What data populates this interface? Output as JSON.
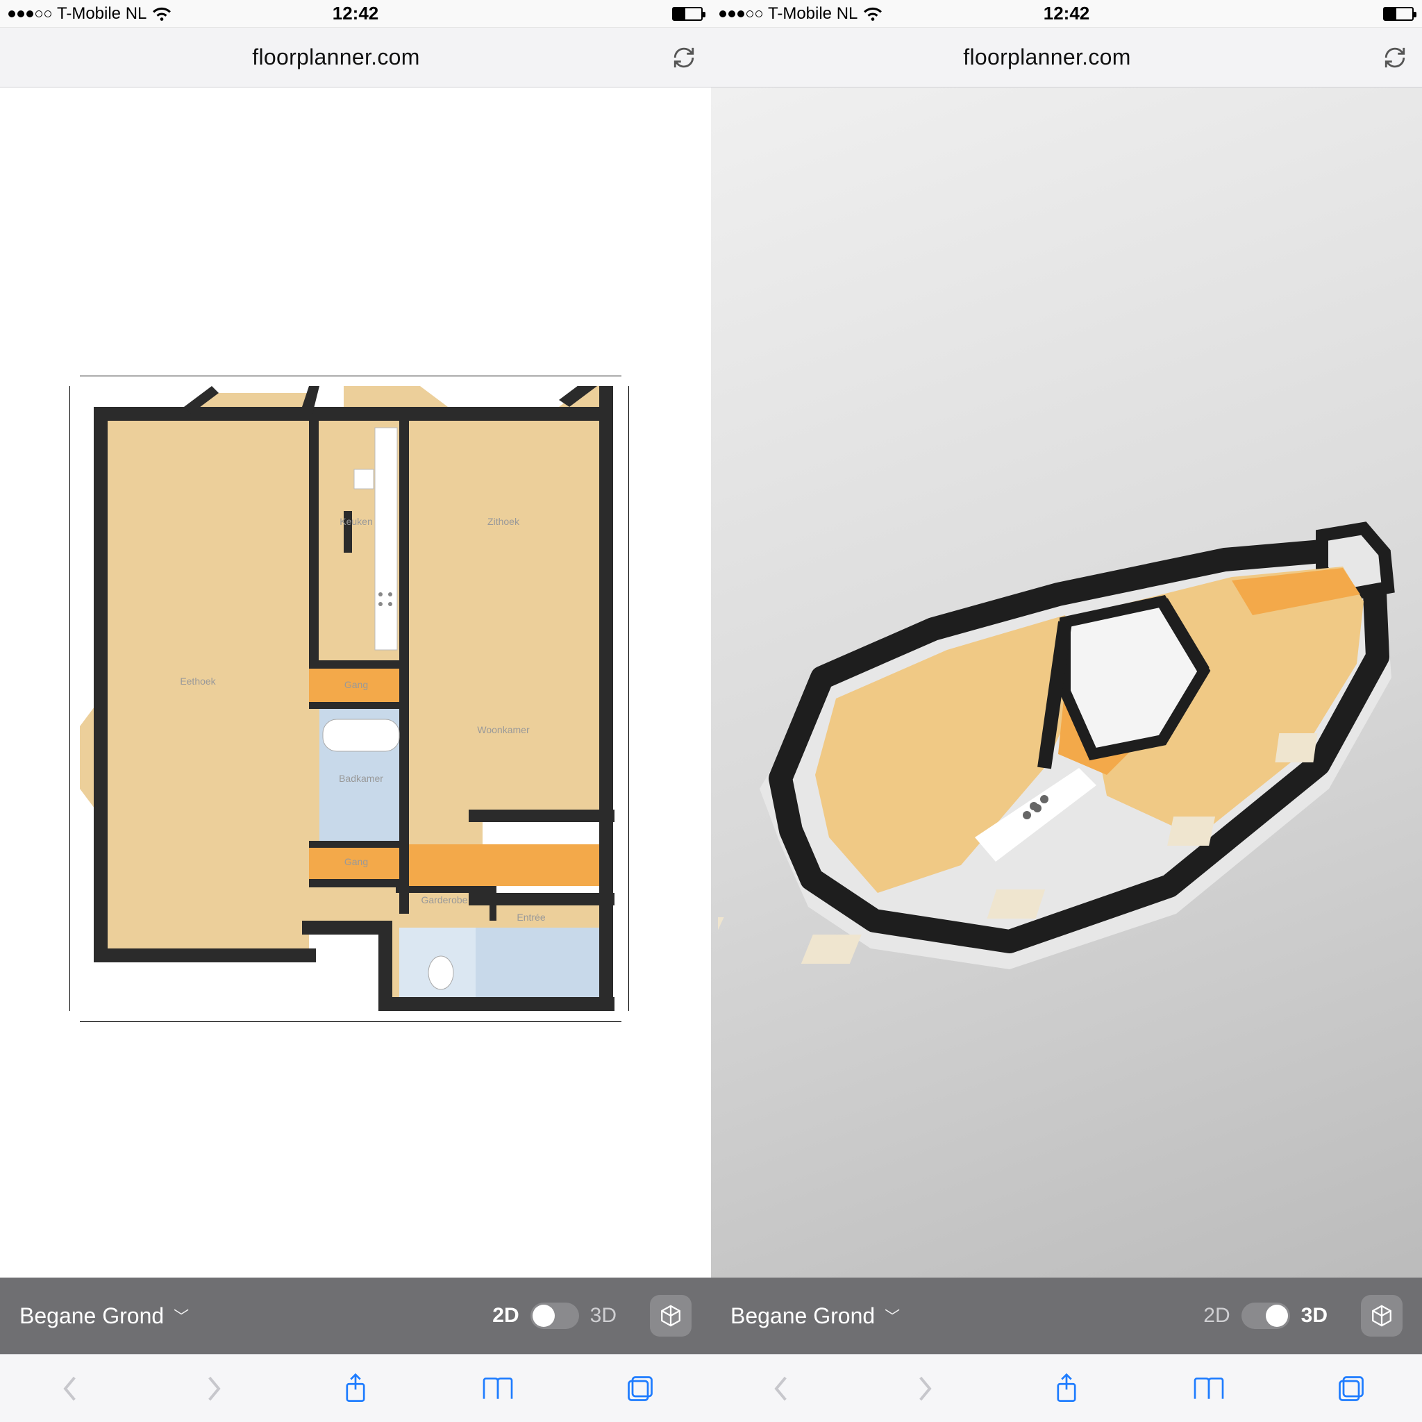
{
  "status": {
    "carrier": "T-Mobile NL",
    "time": "12:42"
  },
  "browser": {
    "url": "floorplanner.com"
  },
  "app": {
    "floor_label": "Begane Grond",
    "view_2d": "2D",
    "view_3d": "3D"
  },
  "rooms": {
    "eethoek": "Eethoek",
    "keuken": "Keuken",
    "zithoek": "Zithoek",
    "gang1": "Gang",
    "gang2": "Gang",
    "badkamer": "Badkamer",
    "woonkamer": "Woonkamer",
    "garderobe": "Garderobe",
    "entree": "Entrée"
  },
  "colors": {
    "floor": "#eccf9a",
    "floor_orange": "#f3a94a",
    "bathroom": "#c8d9ea",
    "wall": "#2b2b2b"
  }
}
